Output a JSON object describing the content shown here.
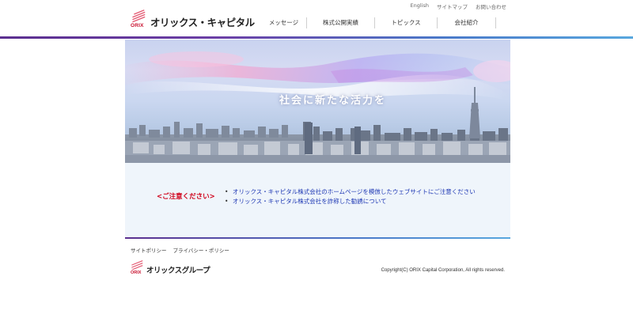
{
  "header": {
    "logo_mark_text": "ORIX",
    "company_name": "オリックス・キャピタル",
    "util_links": [
      "English",
      "サイトマップ",
      "お問い合わせ"
    ],
    "nav": [
      "メッセージ",
      "株式公開実績",
      "トピックス",
      "会社紹介"
    ]
  },
  "hero": {
    "tagline": "社会に新たな活力を"
  },
  "notice": {
    "caution_label": "<ご注意ください>",
    "items": [
      "オリックス・キャピタル株式会社のホームページを模倣したウェブサイトにご注意ください",
      "オリックス・キャピタル株式会社を詐称した勧誘について"
    ]
  },
  "footer": {
    "links": [
      "サイトポリシー",
      "プライバシー・ポリシー"
    ],
    "group_logo_mark_text": "ORIX",
    "group_name": "オリックスグループ",
    "copyright": "Copyright(C) ORIX Capital Corporation, All rights reserved."
  },
  "colors": {
    "brand_red": "#c8102e",
    "accent_purple": "#5b2f8f",
    "accent_blue": "#58a7de",
    "link_blue": "#1c36b3",
    "caution_red": "#d0021b"
  }
}
